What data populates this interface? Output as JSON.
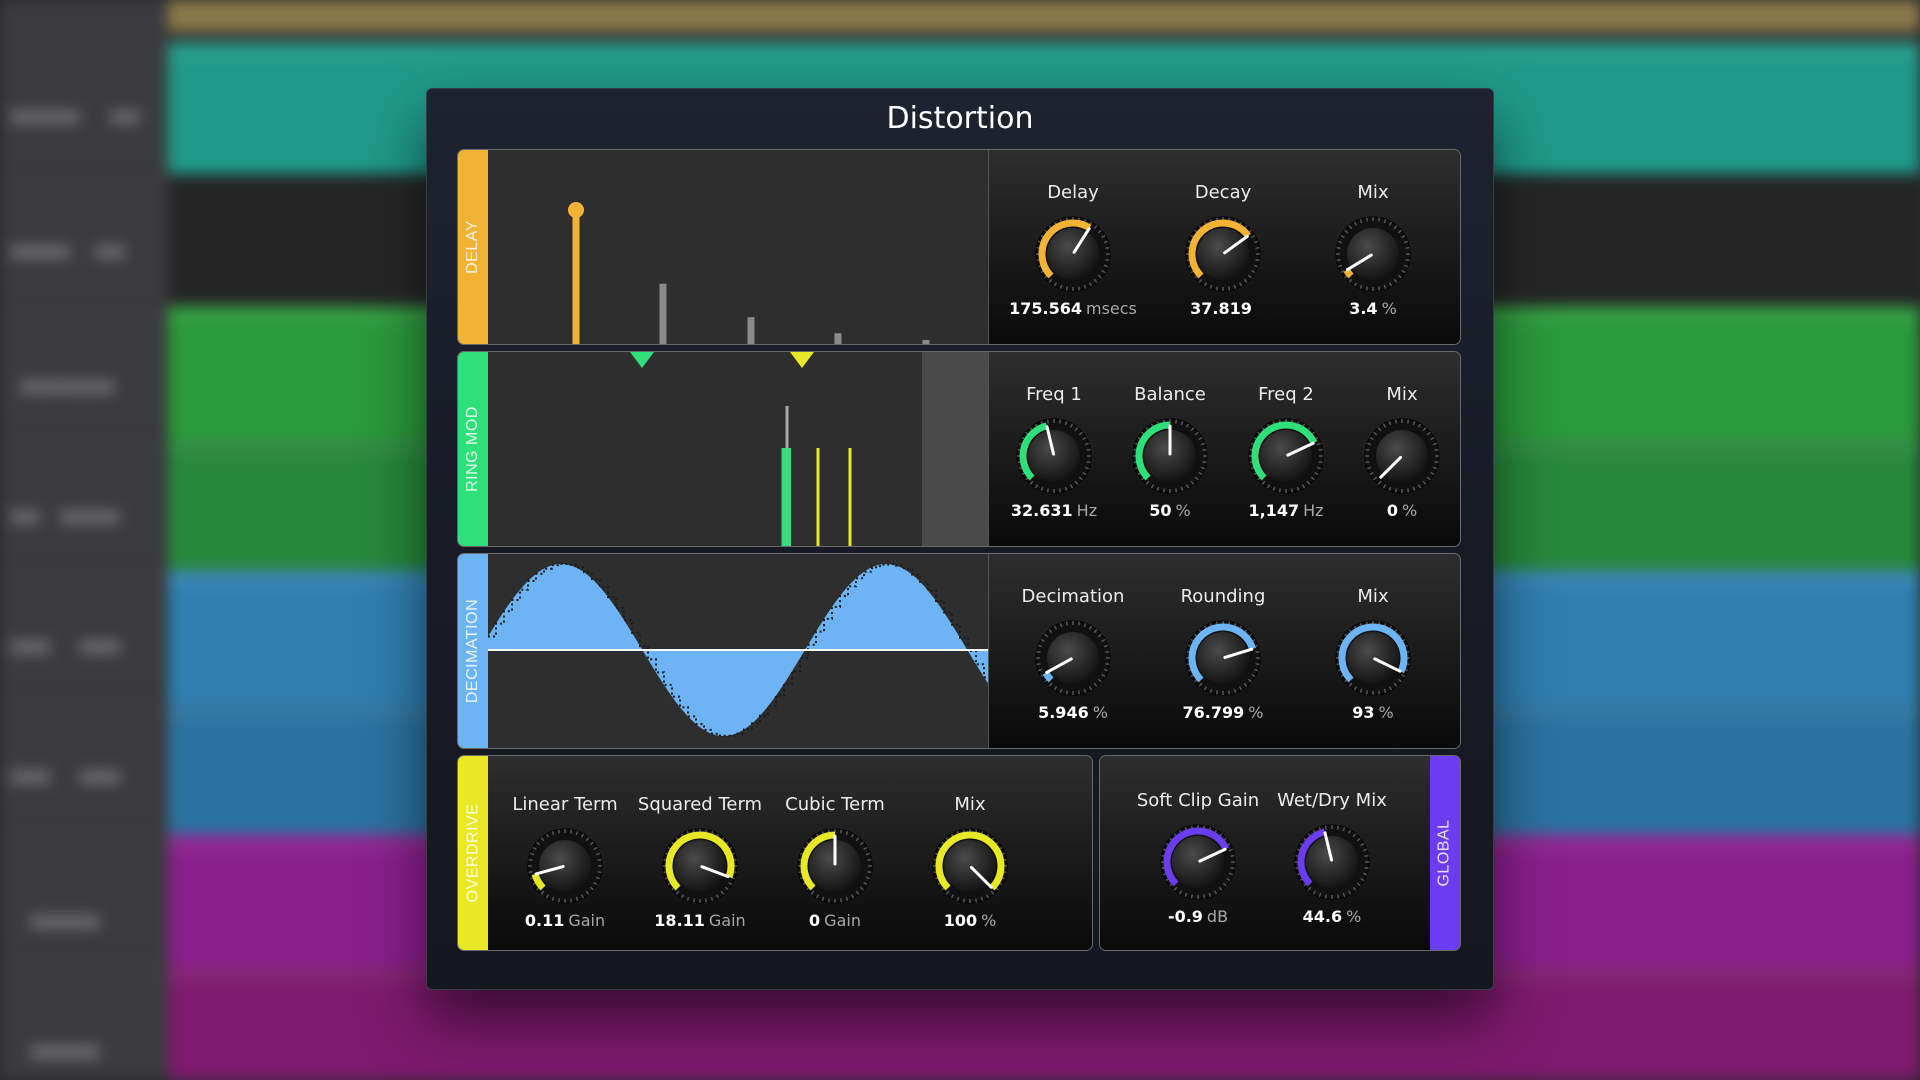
{
  "window": {
    "title": "Distortion"
  },
  "colors": {
    "delay": "#f2b233",
    "ringmod": "#2fe07a",
    "decimation": "#6cb4f5",
    "overdrive": "#e8e827",
    "global": "#6b3cf0",
    "knob_indicator": "#ffffff"
  },
  "modules": {
    "delay": {
      "tab": "DELAY",
      "knobs": [
        {
          "label": "Delay",
          "value": "175.564",
          "unit": "msecs",
          "level": 0.62
        },
        {
          "label": "Decay",
          "value": "37.819",
          "unit": "",
          "level": 0.7
        },
        {
          "label": "Mix",
          "value": "3.4",
          "unit": "%",
          "level": 0.05
        }
      ],
      "taps": [
        1.0,
        0.45,
        0.2,
        0.08,
        0.03
      ]
    },
    "ringmod": {
      "tab": "RING MOD",
      "knobs": [
        {
          "label": "Freq 1",
          "value": "32.631",
          "unit": "Hz",
          "level": 0.45
        },
        {
          "label": "Balance",
          "value": "50",
          "unit": "%",
          "level": 0.5
        },
        {
          "label": "Freq 2",
          "value": "1,147",
          "unit": "Hz",
          "level": 0.74
        },
        {
          "label": "Mix",
          "value": "0",
          "unit": "%",
          "level": 0.0
        }
      ]
    },
    "decimation": {
      "tab": "DECIMATION",
      "knobs": [
        {
          "label": "Decimation",
          "value": "5.946",
          "unit": "%",
          "level": 0.06
        },
        {
          "label": "Rounding",
          "value": "76.799",
          "unit": "%",
          "level": 0.77
        },
        {
          "label": "Mix",
          "value": "93",
          "unit": "%",
          "level": 0.93
        }
      ]
    },
    "overdrive": {
      "tab": "OVERDRIVE",
      "knobs": [
        {
          "label": "Linear Term",
          "value": "0.11",
          "unit": "Gain",
          "level": 0.11
        },
        {
          "label": "Squared Term",
          "value": "18.11",
          "unit": "Gain",
          "level": 0.91
        },
        {
          "label": "Cubic Term",
          "value": "0",
          "unit": "Gain",
          "level": 0.5
        },
        {
          "label": "Mix",
          "value": "100",
          "unit": "%",
          "level": 1.0
        }
      ]
    },
    "global": {
      "tab": "GLOBAL",
      "knobs": [
        {
          "label": "Soft Clip Gain",
          "value": "-0.9",
          "unit": "dB",
          "level": 0.74
        },
        {
          "label": "Wet/Dry Mix",
          "value": "44.6",
          "unit": "%",
          "level": 0.45
        }
      ]
    }
  }
}
